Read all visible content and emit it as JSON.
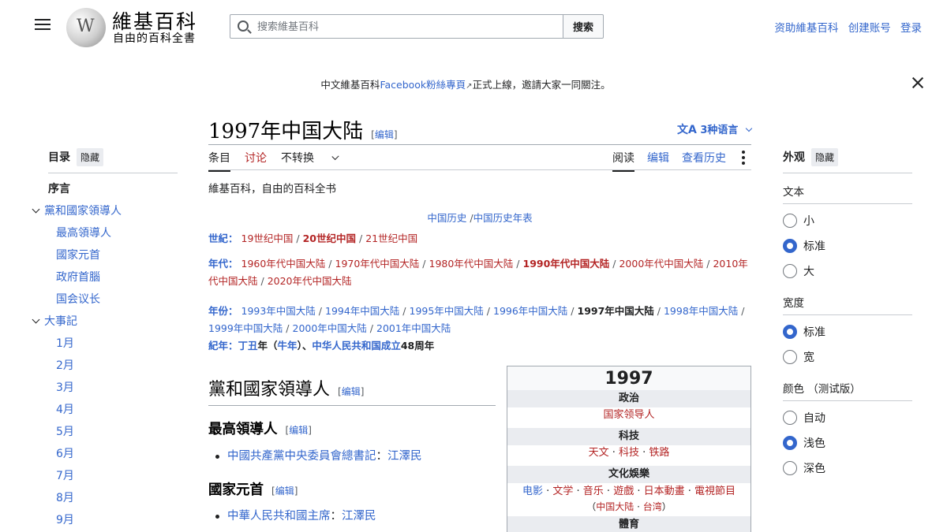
{
  "header": {
    "logo_title": "維基百科",
    "logo_tagline": "自由的百科全書",
    "search_placeholder": "搜索維基百科",
    "search_button": "搜索",
    "user_links": [
      "资助維基百科",
      "创建账号",
      "登录"
    ]
  },
  "notice": {
    "prefix": "中文維基百科",
    "link": "Facebook粉絲專頁",
    "suffix": "正式上線，邀請大家一同關注。"
  },
  "toc": {
    "title": "目录",
    "hide": "隐藏",
    "top": "序言",
    "sections": [
      {
        "label": "黨和國家領導人",
        "items": [
          "最高領導人",
          "國家元首",
          "政府首腦",
          "国会议长"
        ]
      },
      {
        "label": "大事記",
        "items": [
          "1月",
          "2月",
          "3月",
          "4月",
          "5月",
          "6月",
          "7月",
          "8月",
          "9月"
        ]
      }
    ]
  },
  "article": {
    "title": "1997年中国大陆",
    "edit": "编辑",
    "languages": "3种语言",
    "tabs_left": [
      "条目",
      "讨论",
      "不转换"
    ],
    "tabs_right": [
      "阅读",
      "编辑",
      "查看历史"
    ],
    "site_sub": "維基百科，自由的百科全书"
  },
  "navbox": {
    "history": [
      "中国历史",
      "中国历史年表"
    ],
    "century_label": "世紀：",
    "centuries": [
      "19世纪中国",
      "20世纪中国",
      "21世纪中国"
    ],
    "decade_label": "年代：",
    "decades": [
      "1960年代中国大陆",
      "1970年代中国大陆",
      "1980年代中国大陆",
      "1990年代中国大陆",
      "2000年代中国大陆",
      "2010年代中国大陆",
      "2020年代中国大陆"
    ],
    "year_label": "年份：",
    "years": [
      "1993年中国大陆",
      "1994年中国大陆",
      "1995年中国大陆",
      "1996年中国大陆",
      "1997年中国大陆",
      "1998年中国大陆",
      "1999年中国大陆",
      "2000年中国大陆",
      "2001年中国大陆"
    ],
    "era_label": "紀年：",
    "era_ganzhi": "丁丑",
    "era_ganzhi_suffix": "年（",
    "era_zodiac": "牛年",
    "era_zodiac_suffix": "）、",
    "era_prc": "中华人民共和国成立",
    "era_prc_suffix": "48周年"
  },
  "sections": {
    "leaders_heading": "黨和國家領導人",
    "supreme_heading": "最高領導人",
    "supreme_item_title": "中國共產黨中央委員會總書記",
    "supreme_item_person": "江澤民",
    "head_heading": "國家元首",
    "head_item_title": "中華人民共和國主席",
    "head_item_person": "江澤民"
  },
  "infobox": {
    "year": "1997",
    "politics": "政治",
    "politics_link": "国家领导人",
    "tech": "科技",
    "tech_links": [
      "天文",
      "科技",
      "铁路"
    ],
    "culture": "文化娛樂",
    "culture_links": [
      "电影",
      "文学",
      "音乐",
      "遊戲",
      "日本動畫",
      "電視節目"
    ],
    "culture_sub": [
      "中国大陆",
      "台湾"
    ],
    "sports": "體育"
  },
  "appearance": {
    "title": "外观",
    "hide": "隐藏",
    "text_label": "文本",
    "text_options": [
      "小",
      "标准",
      "大"
    ],
    "text_selected": 1,
    "width_label": "宽度",
    "width_options": [
      "标准",
      "宽"
    ],
    "width_selected": 0,
    "color_label": "颜色 （测试版）",
    "color_options": [
      "自动",
      "浅色",
      "深色"
    ],
    "color_selected": 1
  },
  "colors": {
    "link": "#3366cc",
    "redlink": "#b32424",
    "border": "#a2a9b1"
  }
}
